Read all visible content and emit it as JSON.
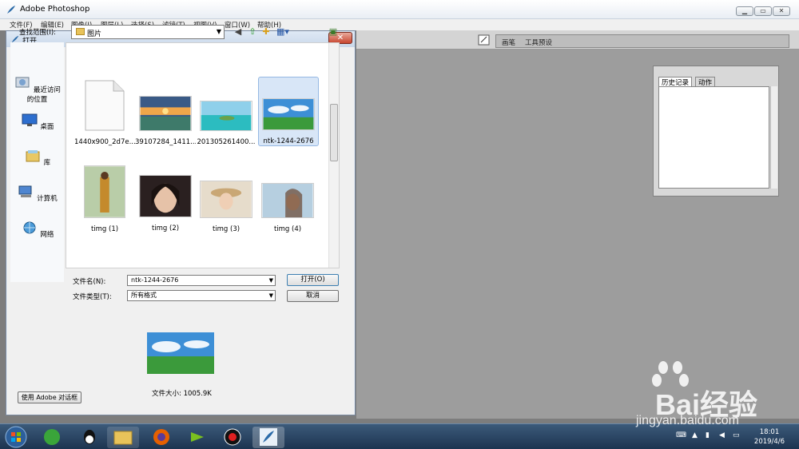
{
  "app": {
    "title": "Adobe Photoshop"
  },
  "menu": [
    "文件(F)",
    "编辑(E)",
    "图像(I)",
    "图层(L)",
    "选择(S)",
    "滤镜(T)",
    "视图(V)",
    "窗口(W)",
    "帮助(H)"
  ],
  "palette_well": {
    "tabs": [
      "画笔",
      "工具预设"
    ]
  },
  "history_panel": {
    "tabs": [
      "历史记录",
      "动作"
    ]
  },
  "dialog": {
    "title": "打开",
    "lookin_label": "查找范围(I):",
    "lookin_value": "图片",
    "places": [
      "最近访问的位置",
      "桌面",
      "库",
      "计算机",
      "网络"
    ],
    "files": [
      {
        "name": "1440x900_2d7e...",
        "kind": "blank"
      },
      {
        "name": "39107284_1411...",
        "kind": "sunset"
      },
      {
        "name": "201305261400...",
        "kind": "island"
      },
      {
        "name": "ntk-1244-2676",
        "kind": "landscape",
        "selected": true
      },
      {
        "name": "timg (1)",
        "kind": "girl1"
      },
      {
        "name": "timg (2)",
        "kind": "girl2"
      },
      {
        "name": "timg (3)",
        "kind": "girl3"
      },
      {
        "name": "timg (4)",
        "kind": "girl4"
      }
    ],
    "filename_label": "文件名(N):",
    "filename_value": "ntk-1244-2676",
    "filetype_label": "文件类型(T):",
    "filetype_value": "所有格式",
    "open_button": "打开(O)",
    "cancel_button": "取消",
    "file_size": "文件大小: 1005.9K",
    "adobe_dialog_button": "使用 Adobe 对话框"
  },
  "taskbar": {
    "time": "18:01",
    "date": "2019/4/6"
  },
  "watermark": {
    "text": "Bai经验",
    "url": "jingyan.baidu.com"
  }
}
